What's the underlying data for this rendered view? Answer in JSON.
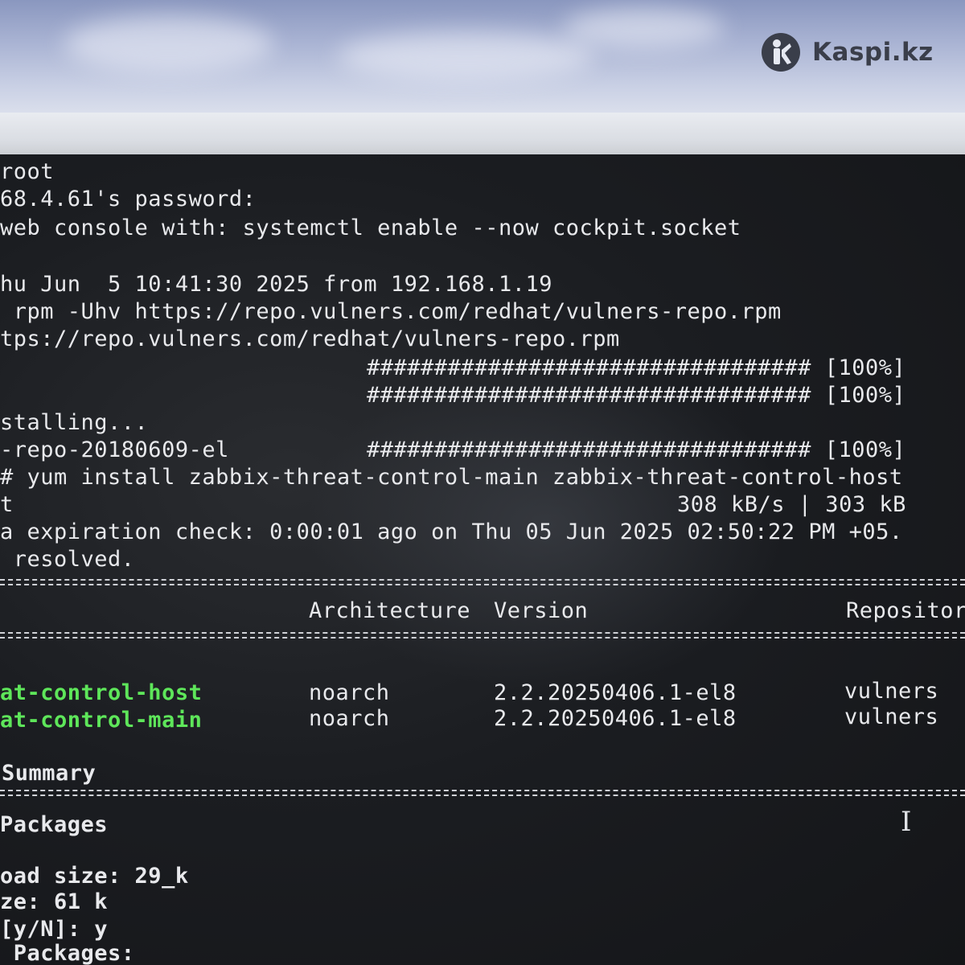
{
  "watermark": {
    "text": "Kaspi.kz",
    "icon": "kaspi-logo-icon"
  },
  "terminal": {
    "lines": {
      "l1": "root",
      "l2": "68.4.61's password:",
      "l3": "web console with: systemctl enable --now cockpit.socket",
      "l4": "hu Jun  5 10:41:30 2025 from 192.168.1.19",
      "l5": " rpm -Uhv https://repo.vulners.com/redhat/vulners-repo.rpm",
      "l6": "tps://repo.vulners.com/redhat/vulners-repo.rpm",
      "l7": "################################# [100%]",
      "l8": "################################# [100%]",
      "l9": "stalling...",
      "l10a": "-repo-20180609-el",
      "l10b": "################################# [100%]",
      "l11": "# yum install zabbix-threat-control-main zabbix-threat-control-host",
      "l12a": "t",
      "l12b": "308 kB/s | 303 kB",
      "l13": "a expiration check: 0:00:01 ago on Thu 05 Jun 2025 02:50:22 PM +05.",
      "l14": " resolved."
    },
    "table": {
      "headers": {
        "architecture": "Architecture",
        "version": "Version",
        "repository": "Repositor"
      },
      "rows": [
        {
          "package": "at-control-host",
          "arch": "noarch",
          "version": "2.2.20250406.1-el8",
          "repo": "vulners"
        },
        {
          "package": "at-control-main",
          "arch": "noarch",
          "version": "2.2.20250406.1-el8",
          "repo": "vulners"
        }
      ]
    },
    "summary": {
      "title": "Summary",
      "packages": "Packages",
      "download_size": "oad size: 29_k",
      "installed_size": "ze: 61 k",
      "prompt": "[y/N]: y",
      "footer": " Packages:"
    }
  },
  "colors": {
    "terminal_bg": "#1b1d21",
    "terminal_text": "#e8e9ec",
    "package_green": "#5ee65a"
  }
}
